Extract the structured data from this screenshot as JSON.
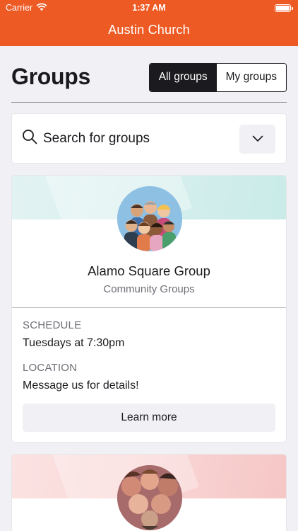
{
  "status_bar": {
    "carrier": "Carrier",
    "time": "1:37 AM"
  },
  "nav": {
    "title": "Austin Church"
  },
  "page": {
    "title": "Groups"
  },
  "segmented": {
    "options": [
      "All groups",
      "My groups"
    ],
    "selected": "All groups"
  },
  "search": {
    "placeholder": "Search for groups"
  },
  "groups": [
    {
      "name": "Alamo Square Group",
      "category": "Community Groups",
      "schedule_label": "SCHEDULE",
      "schedule": "Tuesdays at 7:30pm",
      "location_label": "LOCATION",
      "location": "Message us for details!",
      "button": "Learn more",
      "banner_color": "#d8efee"
    },
    {
      "banner_color": "#f9d6d5"
    }
  ],
  "colors": {
    "accent": "#ee5a24",
    "background": "#f0f0f5",
    "dark": "#1b1b1f"
  },
  "icons": [
    "wifi-icon",
    "battery-icon",
    "search-icon",
    "chevron-down-icon"
  ]
}
